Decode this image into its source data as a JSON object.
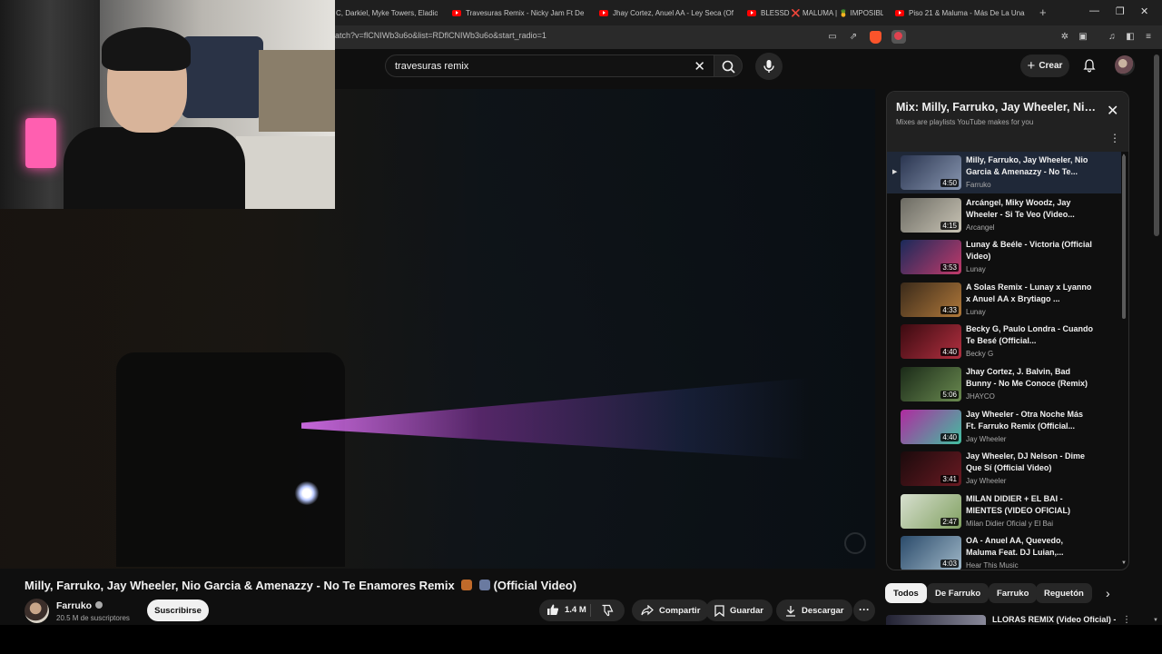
{
  "browser": {
    "tabs": [
      {
        "label": "C, Darkiel, Myke Towers, Eladio"
      },
      {
        "label": "Travesuras Remix - Nicky Jam Ft De"
      },
      {
        "label": "Jhay Cortez, Anuel AA - Ley Seca (Of"
      },
      {
        "label": "BLESSD ❌ MALUMA | 🍍 IMPOSIBL"
      },
      {
        "label": "Piso 21 & Maluma - Más De La Una"
      }
    ],
    "url": "atch?v=flCNIWb3u6o&list=RDflCNIWb3u6o&start_radio=1"
  },
  "header": {
    "search_value": "travesuras remix",
    "create_label": "Crear"
  },
  "video": {
    "title": "Milly, Farruko, Jay Wheeler, Nio Garcia & Amenazzy - No Te Enamores Remix",
    "title_suffix": "(Official Video)",
    "channel": "Farruko",
    "subscribers": "20.5 M de suscriptores",
    "subscribe_label": "Suscribirse",
    "likes": "1.4 M",
    "share_label": "Compartir",
    "save_label": "Guardar",
    "download_label": "Descargar"
  },
  "mix": {
    "title": "Mix: Milly, Farruko, Jay Wheeler, Nio Garcia & Amenazzy",
    "subtitle": "Mixes are playlists YouTube makes for you",
    "items": [
      {
        "title": "Milly, Farruko, Jay Wheeler, Nio Garcia & Amenazzy - No Te...",
        "channel": "Farruko",
        "duration": "4:50",
        "active": true,
        "c1": "#2a3550",
        "c2": "#8896b0"
      },
      {
        "title": "Arcángel, Miky Woodz, Jay Wheeler - Si Te Veo (Video...",
        "channel": "Arcangel",
        "duration": "4:15",
        "c1": "#6b6a62",
        "c2": "#c9c4b5"
      },
      {
        "title": "Lunay & Beéle - Victoria (Official Video)",
        "channel": "Lunay",
        "duration": "3:53",
        "c1": "#1a2a5a",
        "c2": "#c23a6a"
      },
      {
        "title": "A Solas Remix - Lunay x Lyanno x Anuel AA x Brytiago ...",
        "channel": "Lunay",
        "duration": "4:33",
        "c1": "#3a2a1a",
        "c2": "#b0783a"
      },
      {
        "title": "Becky G, Paulo Londra - Cuando Te Besé (Official...",
        "channel": "Becky G",
        "duration": "4:40",
        "c1": "#3a0a10",
        "c2": "#b23040"
      },
      {
        "title": "Jhay Cortez, J. Balvin, Bad Bunny - No Me Conoce (Remix)",
        "channel": "JHAYCO",
        "duration": "5:06",
        "c1": "#1a2a18",
        "c2": "#6a8a50"
      },
      {
        "title": "Jay Wheeler - Otra Noche Más Ft. Farruko Remix (Official...",
        "channel": "Jay Wheeler",
        "duration": "4:40",
        "c1": "#b02aa0",
        "c2": "#40c0a0"
      },
      {
        "title": "Jay Wheeler, DJ Nelson - Dime Que Sí (Official Video)",
        "channel": "Jay Wheeler",
        "duration": "3:41",
        "c1": "#1a0a0c",
        "c2": "#6a1a22"
      },
      {
        "title": "MILAN DIDIER + EL BAI - MIENTES (VIDEO OFICIAL)",
        "channel": "Milan Didier Oficial y El Bai",
        "duration": "2:47",
        "c1": "#d8e0d0",
        "c2": "#80a060"
      },
      {
        "title": "OA - Anuel AA, Quevedo, Maluma Feat. DJ Luian,...",
        "channel": "Hear This Music",
        "duration": "4:03",
        "c1": "#2a4a6a",
        "c2": "#a0b8c8"
      }
    ]
  },
  "chips": [
    {
      "label": "Todos",
      "active": true
    },
    {
      "label": "De Farruko"
    },
    {
      "label": "Farruko"
    },
    {
      "label": "Reguetón"
    }
  ],
  "next_rec": {
    "title": "LLORAS REMIX (Video Oficial) -"
  },
  "colors": {
    "accent_red": "#ff0000",
    "bg": "#0f0f0f",
    "active_row": "#1f2838"
  }
}
